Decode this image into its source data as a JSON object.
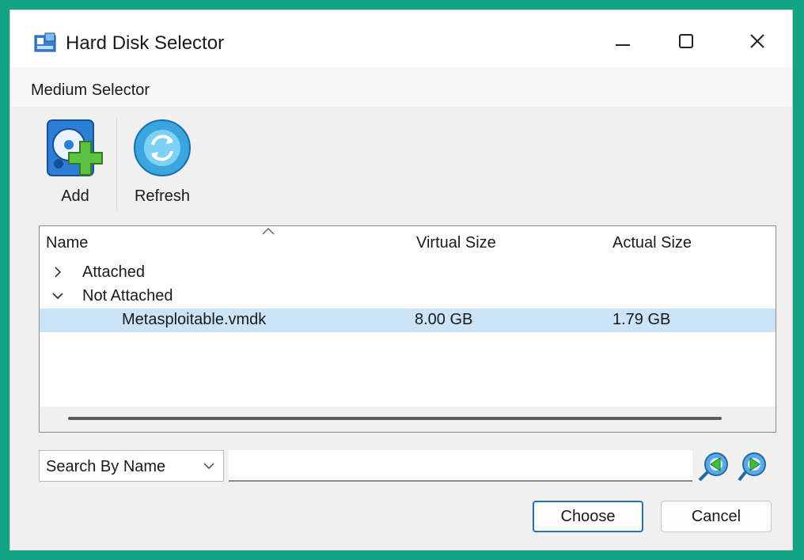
{
  "window": {
    "title": "Hard Disk Selector"
  },
  "menubar": {
    "label": "Medium Selector"
  },
  "toolbar": {
    "add_label": "Add",
    "refresh_label": "Refresh"
  },
  "table": {
    "columns": {
      "name": "Name",
      "virtual_size": "Virtual Size",
      "actual_size": "Actual Size"
    },
    "groups": [
      {
        "label": "Attached",
        "expanded": false
      },
      {
        "label": "Not Attached",
        "expanded": true
      }
    ],
    "rows": [
      {
        "name": "Metasploitable.vmdk",
        "virtual_size": "8.00 GB",
        "actual_size": "1.79 GB",
        "selected": true
      }
    ]
  },
  "search": {
    "mode": "Search By Name",
    "value": "",
    "placeholder": ""
  },
  "buttons": {
    "choose": "Choose",
    "cancel": "Cancel"
  },
  "colors": {
    "background": "#12a383",
    "selection": "#cce4f7",
    "accent": "#2b6fb3"
  }
}
